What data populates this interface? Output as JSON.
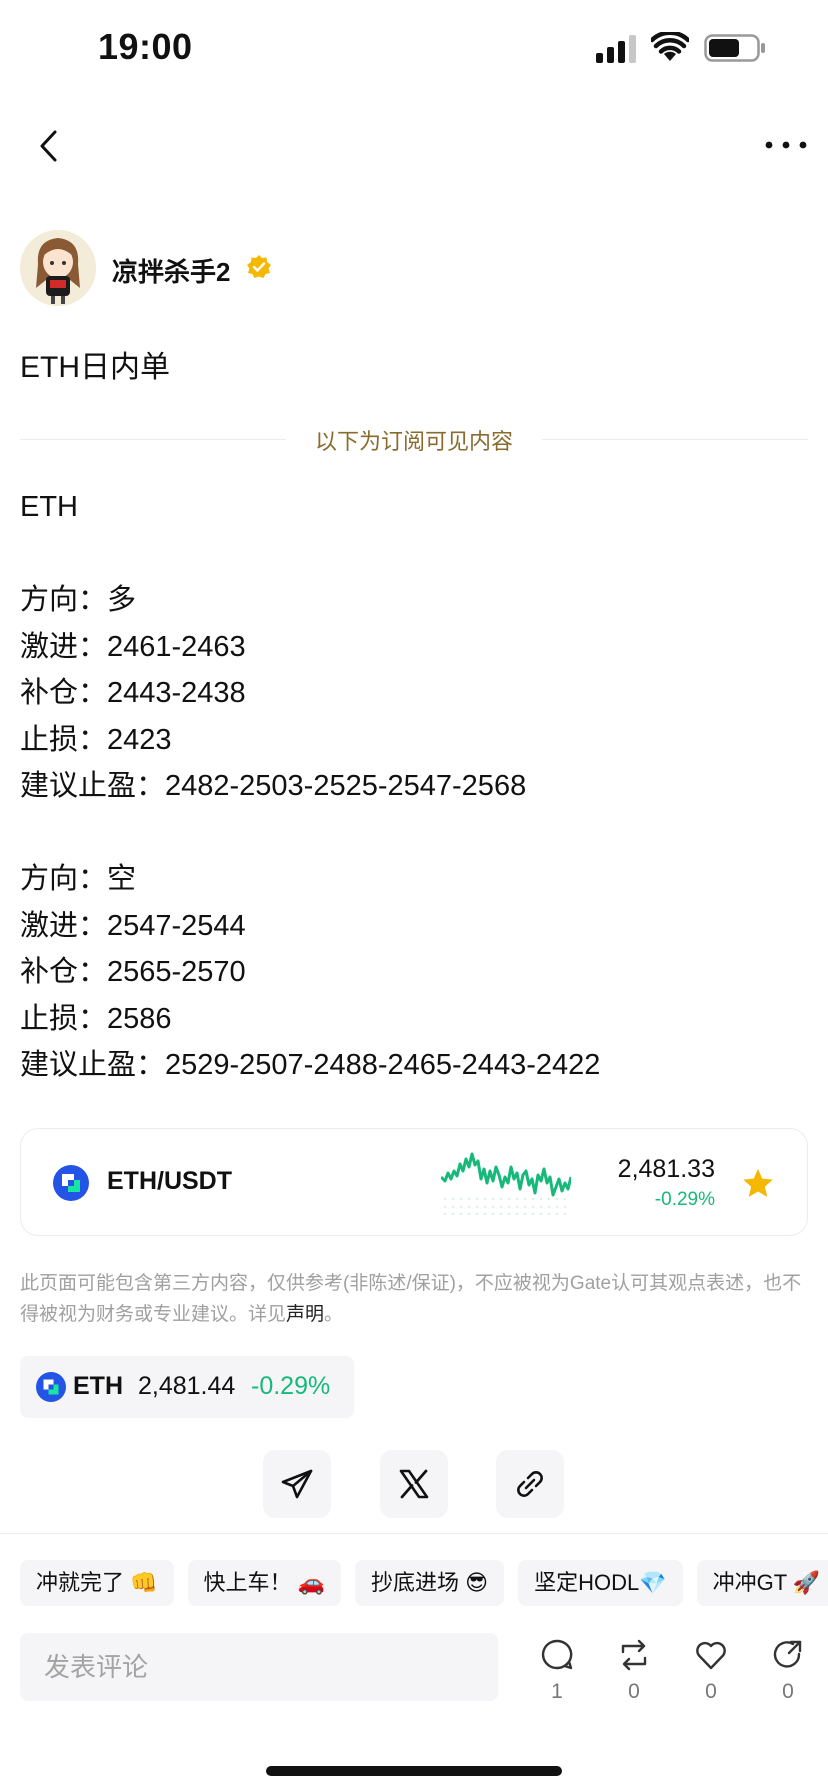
{
  "status_bar": {
    "time": "19:00"
  },
  "author": {
    "name": "凉拌杀手2"
  },
  "post": {
    "title": "ETH日内单",
    "subscriber_divider": "以下为订阅可见内容",
    "lines": [
      "ETH",
      "",
      "方向：多",
      "激进：2461-2463",
      "补仓：2443-2438",
      "止损：2423",
      "建议止盈：2482-2503-2525-2547-2568",
      "",
      "方向：空",
      "激进：2547-2544",
      "补仓：2565-2570",
      "止损：2586",
      "建议止盈：2529-2507-2488-2465-2443-2422"
    ]
  },
  "market_card": {
    "pair": "ETH/USDT",
    "price": "2,481.33",
    "change": "-0.29%",
    "sparkline_color": "#16b979",
    "favorite": true
  },
  "disclaimer": {
    "text": "此页面可能包含第三方内容，仅供参考(非陈述/保证)，不应被视为Gate认可其观点表述，也不得被视为财务或专业建议。详见",
    "link": "声明",
    "end": "。"
  },
  "ticker": {
    "symbol": "ETH",
    "price": "2,481.44",
    "change": "-0.29%"
  },
  "reactions": [
    "冲就完了 👊",
    "快上车！ 🚗",
    "抄底进场 😎",
    "坚定HODL💎",
    "冲冲GT 🚀"
  ],
  "comment": {
    "placeholder": "发表评论"
  },
  "actions": {
    "comments": "1",
    "reposts": "0",
    "likes": "0",
    "shares": "0"
  },
  "colors": {
    "accent_green": "#16b979",
    "gold": "#f5b800",
    "divider_text": "#8a6b2e"
  }
}
